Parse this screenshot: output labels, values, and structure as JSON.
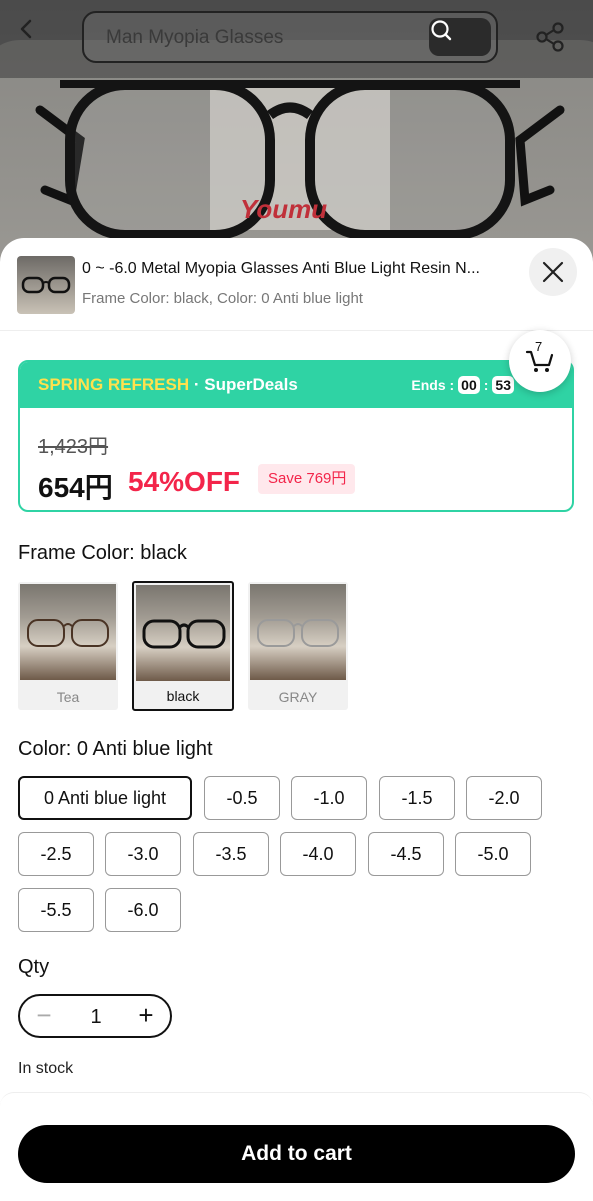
{
  "header": {
    "search_text": "Man Myopia Glasses",
    "photo_watermark": "Youmu"
  },
  "sku": {
    "title": "0 ~ -6.0 Metal Myopia Glasses Anti Blue Light Resin N...",
    "subtitle": "Frame Color: black, Color: 0 Anti blue light"
  },
  "deal": {
    "campaign": "SPRING REFRESH",
    "program": "SuperDeals",
    "ends_label": "Ends :",
    "ends_h": "00",
    "ends_m": "53",
    "original_price": "1,423円",
    "price": "654円",
    "discount": "54%OFF",
    "save": "Save 769円",
    "brand_color": "#2fd3a4",
    "discount_color": "#f3254a"
  },
  "cart": {
    "count": "7"
  },
  "frame_color": {
    "label": "Frame Color: black",
    "options": [
      {
        "label": "Tea",
        "selected": false
      },
      {
        "label": "black",
        "selected": true
      },
      {
        "label": "GRAY",
        "selected": false
      }
    ]
  },
  "color": {
    "label": "Color: 0 Anti blue light",
    "options": [
      "0 Anti blue light",
      "-0.5",
      "-1.0",
      "-1.5",
      "-2.0",
      "-2.5",
      "-3.0",
      "-3.5",
      "-4.0",
      "-4.5",
      "-5.0",
      "-5.5",
      "-6.0"
    ],
    "selected": "0 Anti blue light"
  },
  "qty": {
    "label": "Qty",
    "value": "1",
    "minus": "−",
    "plus": "+"
  },
  "stock": "In stock",
  "add_to_cart": "Add to cart",
  "icons": [
    "back-arrow-icon",
    "search-icon",
    "share-icon",
    "close-icon",
    "cart-icon"
  ]
}
